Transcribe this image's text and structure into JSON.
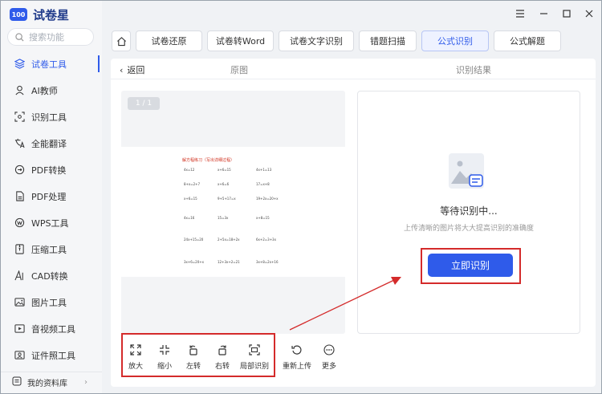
{
  "app": {
    "brand": "试卷星",
    "logo_badge": "100"
  },
  "search": {
    "placeholder": "搜索功能"
  },
  "sidebar": {
    "items": [
      {
        "label": "试卷工具",
        "icon": "layers-icon",
        "active": true
      },
      {
        "label": "AI教师",
        "icon": "teacher-icon"
      },
      {
        "label": "识别工具",
        "icon": "scan-icon"
      },
      {
        "label": "全能翻译",
        "icon": "translate-icon"
      },
      {
        "label": "PDF转换",
        "icon": "pdf-convert-icon"
      },
      {
        "label": "PDF处理",
        "icon": "pdf-process-icon"
      },
      {
        "label": "WPS工具",
        "icon": "wps-icon"
      },
      {
        "label": "压缩工具",
        "icon": "compress-icon"
      },
      {
        "label": "CAD转换",
        "icon": "cad-icon"
      },
      {
        "label": "图片工具",
        "icon": "image-icon"
      },
      {
        "label": "音视频工具",
        "icon": "media-icon"
      },
      {
        "label": "证件照工具",
        "icon": "id-photo-icon"
      }
    ],
    "footer": {
      "label": "我的资料库"
    }
  },
  "tabs": [
    {
      "label": "试卷还原"
    },
    {
      "label": "试卷转Word"
    },
    {
      "label": "试卷文字识别"
    },
    {
      "label": "错题扫描"
    },
    {
      "label": "公式识别",
      "active": true
    },
    {
      "label": "公式解题"
    }
  ],
  "topbar": {
    "back": "返回",
    "original": "原图",
    "result": "识别结果"
  },
  "preview": {
    "pager": "1 / 1",
    "sheet_title": "解方程练习（写出详细过程）",
    "equations": [
      [
        "4x=12",
        "x+6=15",
        "4x+1=13"
      ],
      [
        "8+x=2+7",
        "x+6=6",
        "17=x+8"
      ],
      [
        "x+6=15",
        "9+5+17=x",
        "19+2x=20+x"
      ],
      [
        "4x=16",
        "15=3x",
        "x+8=15"
      ],
      [
        "24x+15=20",
        "2+5x=18+2x",
        "6x+2=3+3x"
      ],
      [
        "3x+6=20+x",
        "12+3x+2=21",
        "3x+8=2x+16"
      ]
    ]
  },
  "result": {
    "status": "等待识别中...",
    "hint": "上传清晰的图片将大大提高识别的准确度",
    "recognize_button": "立即识别"
  },
  "tools": [
    {
      "label": "放大",
      "icon": "zoom-in-icon"
    },
    {
      "label": "缩小",
      "icon": "zoom-out-icon"
    },
    {
      "label": "左转",
      "icon": "rotate-left-icon"
    },
    {
      "label": "右转",
      "icon": "rotate-right-icon"
    },
    {
      "label": "局部识别",
      "icon": "crop-icon"
    },
    {
      "label": "重新上传",
      "icon": "reupload-icon"
    },
    {
      "label": "更多",
      "icon": "more-icon"
    }
  ],
  "colors": {
    "accent": "#2f5bea",
    "highlight": "#d42b2b"
  }
}
